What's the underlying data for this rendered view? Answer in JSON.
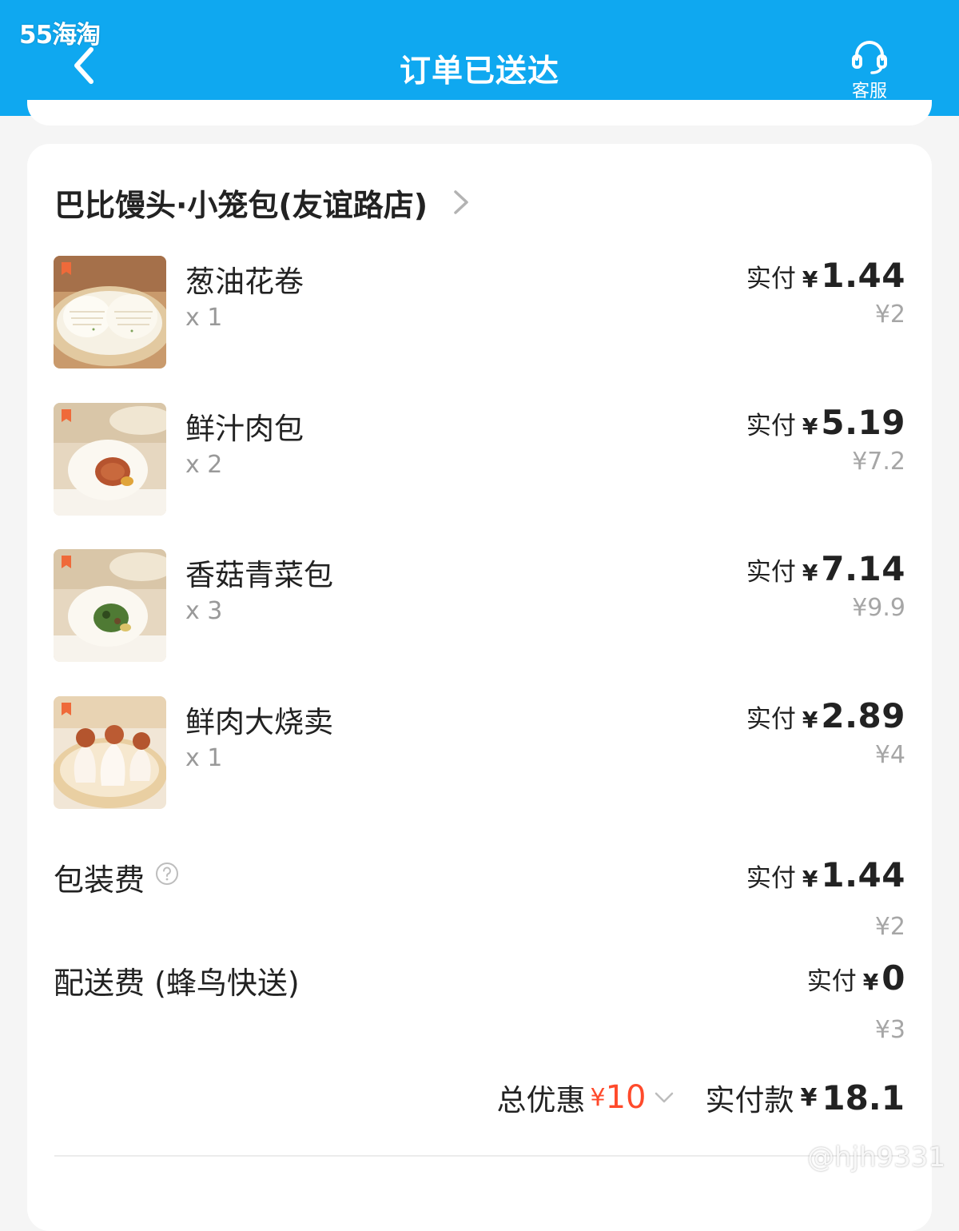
{
  "app_badge": "55海淘",
  "header": {
    "title": "订单已送达",
    "service_label": "客服",
    "color": "#0fa8f0"
  },
  "shop": {
    "name": "巴比馒头·小笼包(友谊路店)"
  },
  "items": [
    {
      "name": "葱油花卷",
      "qty": "x 1",
      "pay_label": "实付",
      "currency": "¥",
      "paid": "1.44",
      "original": "¥2",
      "image": "scallion-roll-image"
    },
    {
      "name": "鲜汁肉包",
      "qty": "x 2",
      "pay_label": "实付",
      "currency": "¥",
      "paid": "5.19",
      "original": "¥7.2",
      "image": "pork-bun-image"
    },
    {
      "name": "香菇青菜包",
      "qty": "x 3",
      "pay_label": "实付",
      "currency": "¥",
      "paid": "7.14",
      "original": "¥9.9",
      "image": "mushroom-veggie-bun-image"
    },
    {
      "name": "鲜肉大烧卖",
      "qty": "x 1",
      "pay_label": "实付",
      "currency": "¥",
      "paid": "2.89",
      "original": "¥4",
      "image": "shaomai-image"
    }
  ],
  "fees": [
    {
      "name": "包装费",
      "pay_label": "实付",
      "currency": "¥",
      "paid": "1.44",
      "original": "¥2"
    },
    {
      "name": "配送费 (蜂鸟快送)",
      "pay_label": "实付",
      "currency": "¥",
      "paid": "0",
      "original": "¥3"
    }
  ],
  "summary": {
    "discount_label": "总优惠",
    "discount_currency": "¥",
    "discount_amount": "10",
    "total_label": "实付款",
    "total_currency": "¥",
    "total_amount": "18.1"
  },
  "colors": {
    "accent": "#0fa8f0",
    "discount": "#ff4a2b"
  },
  "watermark": "@hjh9331"
}
